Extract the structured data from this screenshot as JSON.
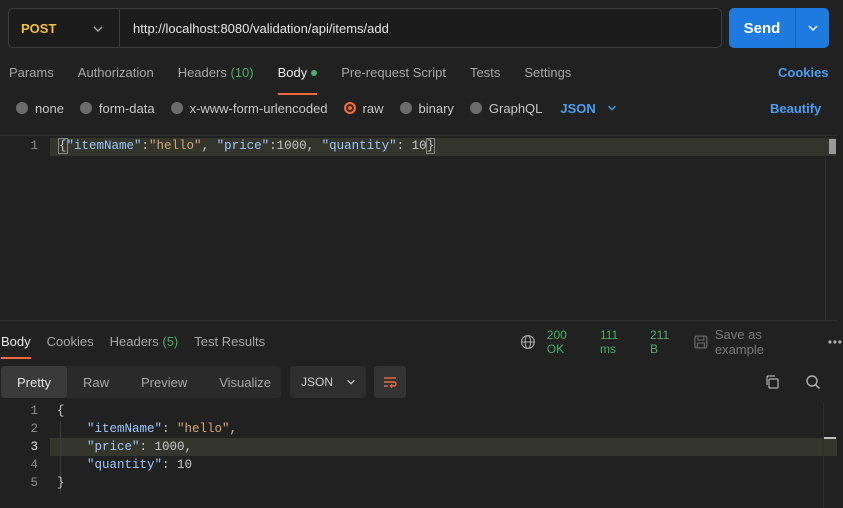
{
  "request": {
    "method": "POST",
    "url": "http://localhost:8080/validation/api/items/add",
    "send_label": "Send"
  },
  "req_tabs": [
    {
      "label": "Params"
    },
    {
      "label": "Authorization"
    },
    {
      "label": "Headers",
      "count": "(10)"
    },
    {
      "label": "Body",
      "active": true
    },
    {
      "label": "Pre-request Script"
    },
    {
      "label": "Tests"
    },
    {
      "label": "Settings"
    }
  ],
  "cookies_link": "Cookies",
  "body_types": [
    "none",
    "form-data",
    "x-www-form-urlencoded",
    "raw",
    "binary",
    "GraphQL"
  ],
  "body_type_selected": "raw",
  "body_format": "JSON",
  "beautify_label": "Beautify",
  "request_body": {
    "line_number": "1",
    "open": "{",
    "key1": "\"itemName\"",
    "val1": "\"hello\"",
    "key2": "\"price\"",
    "val2": "1000",
    "key3": "\"quantity\"",
    "val3": "10",
    "close": "}"
  },
  "resp_tabs": [
    {
      "label": "Body",
      "active": true
    },
    {
      "label": "Cookies"
    },
    {
      "label": "Headers",
      "count": "(5)"
    },
    {
      "label": "Test Results"
    }
  ],
  "response_meta": {
    "status": "200 OK",
    "time": "111 ms",
    "size": "211 B",
    "save_label": "Save as example"
  },
  "view_tabs": [
    "Pretty",
    "Raw",
    "Preview",
    "Visualize"
  ],
  "view_format": "JSON",
  "response_body": {
    "line_numbers": [
      "1",
      "2",
      "3",
      "4",
      "5"
    ],
    "open": "{",
    "key1": "\"itemName\"",
    "val1": "\"hello\"",
    "key2": "\"price\"",
    "val2": "1000",
    "key3": "\"quantity\"",
    "val3": "10",
    "close": "}"
  },
  "colors": {
    "accent": "#f26b3a",
    "send": "#1f7ae0",
    "method": "#f0c040",
    "success": "#48b06a",
    "link": "#4a9ff0"
  }
}
